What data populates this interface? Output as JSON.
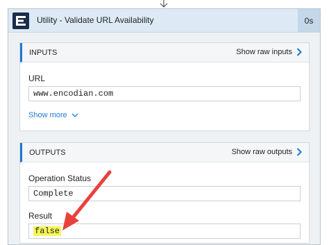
{
  "action": {
    "title": "Utility - Validate URL Availability",
    "duration": "0s"
  },
  "inputs": {
    "header": "INPUTS",
    "show_raw_label": "Show raw inputs",
    "url_label": "URL",
    "url_value": "www.encodian.com",
    "show_more_label": "Show more"
  },
  "outputs": {
    "header": "OUTPUTS",
    "show_raw_label": "Show raw outputs",
    "operation_status_label": "Operation Status",
    "operation_status_value": "Complete",
    "result_label": "Result",
    "result_value": "false"
  },
  "colors": {
    "accent": "#1d78d6",
    "header_bg": "#ddeaf5",
    "highlight": "#f6f55a",
    "annotation_arrow": "#e8413c"
  },
  "icons": {
    "logo": "encodian-logo-icon",
    "show_raw": "chevron-right-icon",
    "show_more": "chevron-down-icon",
    "connector": "down-arrow-icon"
  }
}
